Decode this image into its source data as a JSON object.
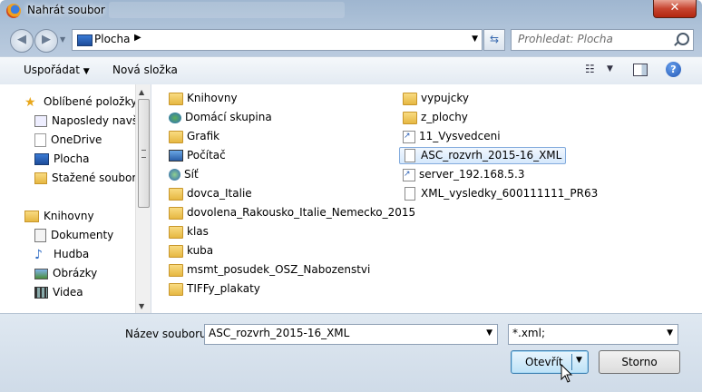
{
  "window": {
    "title": "Nahrát soubor",
    "close_label": "✕"
  },
  "nav": {
    "address_location": "Plocha",
    "search_placeholder": "Prohledat: Plocha"
  },
  "toolbar": {
    "organize_label": "Uspořádat",
    "new_folder_label": "Nová složka",
    "help_label": "?"
  },
  "sidebar": {
    "items": [
      {
        "label": "Oblíbené položky",
        "icon": "star-icon"
      },
      {
        "label": "Naposledy navšti",
        "icon": "recent-places-icon"
      },
      {
        "label": "OneDrive",
        "icon": "onedrive-icon"
      },
      {
        "label": "Plocha",
        "icon": "desktop-icon"
      },
      {
        "label": "Stažené soubory",
        "icon": "downloads-icon"
      },
      {
        "label": "Knihovny",
        "icon": "libraries-icon"
      },
      {
        "label": "Dokumenty",
        "icon": "documents-icon"
      },
      {
        "label": "Hudba",
        "icon": "music-icon"
      },
      {
        "label": "Obrázky",
        "icon": "pictures-icon"
      },
      {
        "label": "Videa",
        "icon": "videos-icon"
      }
    ]
  },
  "files": {
    "col1": [
      {
        "name": "Knihovny",
        "type": "library"
      },
      {
        "name": "Domácí skupina",
        "type": "homegroup"
      },
      {
        "name": "Grafik",
        "type": "user"
      },
      {
        "name": "Počítač",
        "type": "computer"
      },
      {
        "name": "Síť",
        "type": "network"
      },
      {
        "name": "dovca_Italie",
        "type": "folder"
      },
      {
        "name": "dovolena_Rakousko_Italie_Nemecko_2015",
        "type": "folder"
      },
      {
        "name": "klas",
        "type": "folder"
      },
      {
        "name": "kuba",
        "type": "folder"
      },
      {
        "name": "msmt_posudek_OSZ_Nabozenstvi",
        "type": "folder"
      },
      {
        "name": "TIFFy_plakaty",
        "type": "folder"
      }
    ],
    "col2": [
      {
        "name": "vypujcky",
        "type": "folder"
      },
      {
        "name": "z_plochy",
        "type": "folder"
      },
      {
        "name": "11_Vysvedceni",
        "type": "shortcut"
      },
      {
        "name": "ASC_rozvrh_2015-16_XML",
        "type": "document",
        "selected": true
      },
      {
        "name": "server_192.168.5.3",
        "type": "shortcut"
      },
      {
        "name": "XML_vysledky_600111111_PR63",
        "type": "document"
      }
    ]
  },
  "bottom": {
    "filename_label": "Název souboru:",
    "filename_value": "ASC_rozvrh_2015-16_XML",
    "filter_value": "*.xml;",
    "open_label": "Otevřít",
    "cancel_label": "Storno"
  }
}
